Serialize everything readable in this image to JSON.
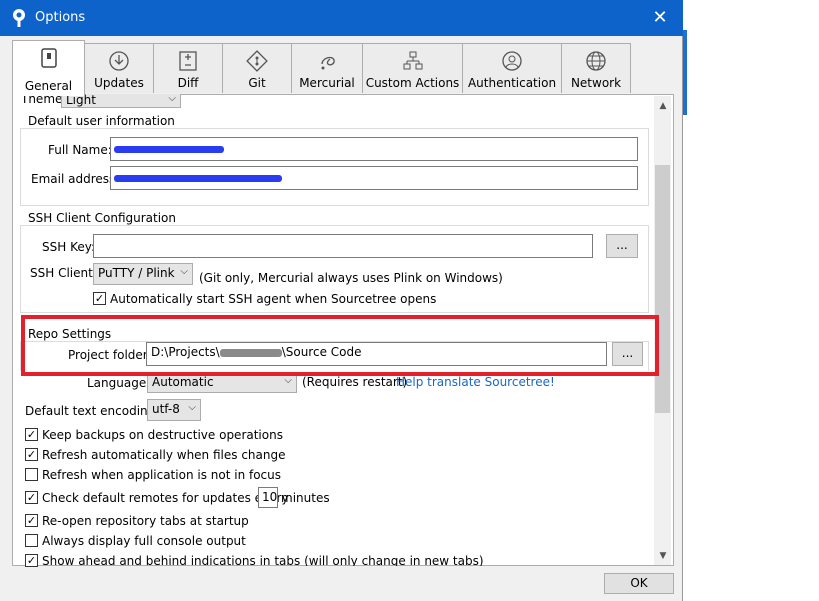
{
  "window": {
    "title": "Options",
    "close_icon": "close-icon",
    "app_icon": "sourcetree-icon"
  },
  "tabs": [
    {
      "label": "General",
      "icon": "general-icon",
      "active": true
    },
    {
      "label": "Updates",
      "icon": "download-icon"
    },
    {
      "label": "Diff",
      "icon": "diff-icon"
    },
    {
      "label": "Git",
      "icon": "git-icon"
    },
    {
      "label": "Mercurial",
      "icon": "mercurial-icon"
    },
    {
      "label": "Custom Actions",
      "icon": "custom-actions-icon"
    },
    {
      "label": "Authentication",
      "icon": "user-icon"
    },
    {
      "label": "Network",
      "icon": "globe-icon"
    }
  ],
  "theme": {
    "label": "Theme:",
    "value": "Light"
  },
  "user_info": {
    "title": "Default user information",
    "full_name_label": "Full Name:",
    "email_label": "Email address:"
  },
  "ssh": {
    "title": "SSH Client Configuration",
    "key_label": "SSH Key:",
    "key_value": "",
    "browse_label": "...",
    "client_label": "SSH Client:",
    "client_value": "PuTTY / Plink",
    "client_note": "(Git only, Mercurial always uses Plink on Windows)",
    "auto_agent_label": "Automatically start SSH agent when Sourcetree opens",
    "auto_agent_checked": true
  },
  "repo": {
    "title": "Repo Settings",
    "project_folder_label": "Project folder:",
    "project_folder_prefix": "D:\\Projects\\",
    "project_folder_suffix": "\\Source Code",
    "browse_label": "..."
  },
  "language": {
    "label": "Language:",
    "value": "Automatic",
    "note": "(Requires restart)",
    "link": "Help translate Sourcetree!"
  },
  "encoding": {
    "label": "Default text encoding:",
    "value": "utf-8"
  },
  "options": [
    {
      "label": "Keep backups on destructive operations",
      "checked": true
    },
    {
      "label": "Refresh automatically when files change",
      "checked": true
    },
    {
      "label": "Refresh when application is not in focus",
      "checked": false
    },
    {
      "label": "Check default remotes for updates every",
      "checked": true,
      "minutes": "10",
      "suffix": "minutes"
    },
    {
      "label": "Re-open repository tabs at startup",
      "checked": true
    },
    {
      "label": "Always display full console output",
      "checked": false
    },
    {
      "label": "Show ahead and behind indications in tabs (will only change in new tabs)",
      "checked": true
    }
  ],
  "footer": {
    "ok_label": "OK"
  },
  "colors": {
    "titlebar": "#0d63c9",
    "highlight": "#e3212a",
    "redaction": "#2a3cf0",
    "link": "#1a66c2"
  }
}
